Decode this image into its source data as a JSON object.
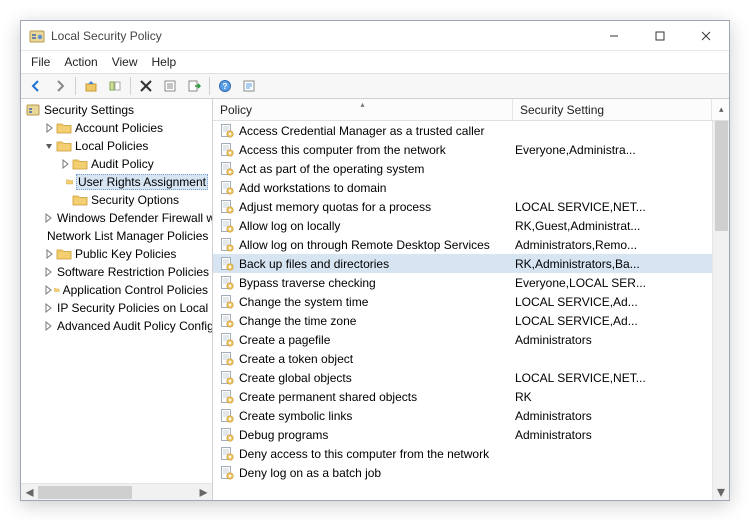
{
  "window": {
    "title": "Local Security Policy"
  },
  "menu": {
    "file": "File",
    "action": "Action",
    "view": "View",
    "help": "Help"
  },
  "tree": {
    "root": "Security Settings",
    "items": [
      {
        "label": "Account Policies",
        "depth": 1,
        "twisty": "closed"
      },
      {
        "label": "Local Policies",
        "depth": 1,
        "twisty": "open"
      },
      {
        "label": "Audit Policy",
        "depth": 2,
        "twisty": "closed"
      },
      {
        "label": "User Rights Assignment",
        "depth": 2,
        "twisty": "none",
        "selected": true
      },
      {
        "label": "Security Options",
        "depth": 2,
        "twisty": "none"
      },
      {
        "label": "Windows Defender Firewall with",
        "depth": 1,
        "twisty": "closed"
      },
      {
        "label": "Network List Manager Policies",
        "depth": 1,
        "twisty": "none"
      },
      {
        "label": "Public Key Policies",
        "depth": 1,
        "twisty": "closed"
      },
      {
        "label": "Software Restriction Policies",
        "depth": 1,
        "twisty": "closed"
      },
      {
        "label": "Application Control Policies",
        "depth": 1,
        "twisty": "closed"
      },
      {
        "label": "IP Security Policies on Local Com",
        "depth": 1,
        "twisty": "closed",
        "icon": "ipsec"
      },
      {
        "label": "Advanced Audit Policy Configura",
        "depth": 1,
        "twisty": "closed"
      }
    ]
  },
  "list": {
    "columns": {
      "policy": "Policy",
      "setting": "Security Setting"
    },
    "rows": [
      {
        "policy": "Access Credential Manager as a trusted caller",
        "setting": ""
      },
      {
        "policy": "Access this computer from the network",
        "setting": "Everyone,Administra..."
      },
      {
        "policy": "Act as part of the operating system",
        "setting": ""
      },
      {
        "policy": "Add workstations to domain",
        "setting": ""
      },
      {
        "policy": "Adjust memory quotas for a process",
        "setting": "LOCAL SERVICE,NET..."
      },
      {
        "policy": "Allow log on locally",
        "setting": "RK,Guest,Administrat..."
      },
      {
        "policy": "Allow log on through Remote Desktop Services",
        "setting": "Administrators,Remo..."
      },
      {
        "policy": "Back up files and directories",
        "setting": "RK,Administrators,Ba...",
        "selected": true
      },
      {
        "policy": "Bypass traverse checking",
        "setting": "Everyone,LOCAL SER..."
      },
      {
        "policy": "Change the system time",
        "setting": "LOCAL SERVICE,Ad..."
      },
      {
        "policy": "Change the time zone",
        "setting": "LOCAL SERVICE,Ad..."
      },
      {
        "policy": "Create a pagefile",
        "setting": "Administrators"
      },
      {
        "policy": "Create a token object",
        "setting": ""
      },
      {
        "policy": "Create global objects",
        "setting": "LOCAL SERVICE,NET..."
      },
      {
        "policy": "Create permanent shared objects",
        "setting": "RK"
      },
      {
        "policy": "Create symbolic links",
        "setting": "Administrators"
      },
      {
        "policy": "Debug programs",
        "setting": "Administrators"
      },
      {
        "policy": "Deny access to this computer from the network",
        "setting": ""
      },
      {
        "policy": "Deny log on as a batch job",
        "setting": ""
      }
    ]
  }
}
